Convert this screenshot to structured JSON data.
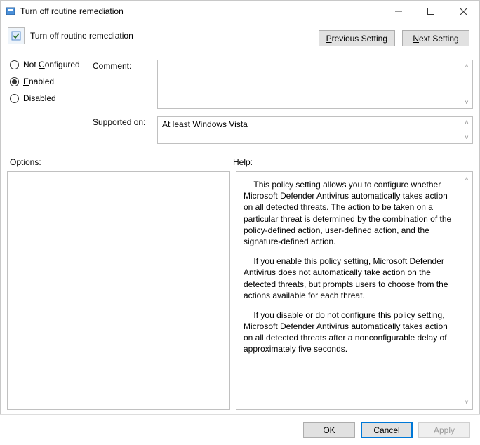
{
  "window": {
    "title": "Turn off routine remediation"
  },
  "header": {
    "policy_title": "Turn off routine remediation",
    "prev_label": "Previous Setting",
    "next_label": "Next Setting"
  },
  "radios": {
    "not_configured": "Not Configured",
    "enabled": "Enabled",
    "disabled": "Disabled",
    "selected": "enabled"
  },
  "fields": {
    "comment_label": "Comment:",
    "comment_value": "",
    "supported_label": "Supported on:",
    "supported_value": "At least Windows Vista"
  },
  "sections": {
    "options_label": "Options:",
    "help_label": "Help:"
  },
  "help": {
    "p1": "This policy setting allows you to configure whether Microsoft Defender Antivirus automatically takes action on all detected threats. The action to be taken on a particular threat is determined by the combination of the policy-defined action, user-defined action, and the signature-defined action.",
    "p2": "If you enable this policy setting, Microsoft Defender Antivirus does not automatically take action on the detected threats, but prompts users to choose from the actions available for each threat.",
    "p3": "If you disable or do not configure this policy setting, Microsoft Defender Antivirus automatically takes action on all detected threats after a nonconfigurable delay of approximately five seconds."
  },
  "footer": {
    "ok": "OK",
    "cancel": "Cancel",
    "apply": "Apply"
  }
}
